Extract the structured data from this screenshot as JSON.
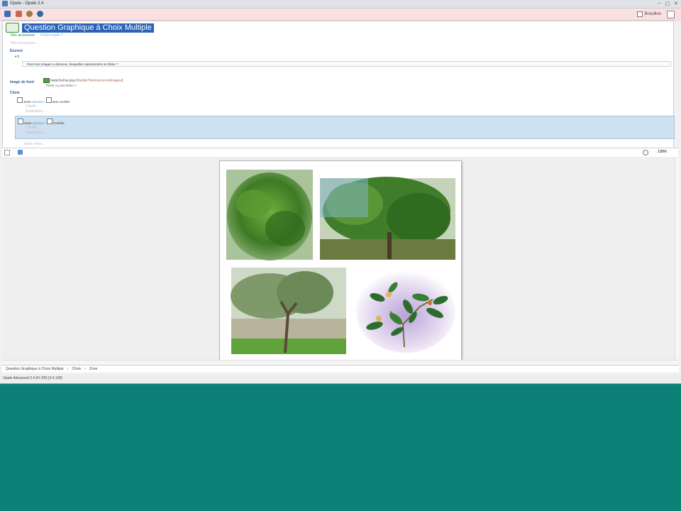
{
  "window": {
    "title": "Opale - Opale 3.4"
  },
  "toolbar": {
    "draft_label": "Brouillon"
  },
  "question": {
    "title": "Question Graphique à Choix Multiple",
    "tabs": [
      "Titre accessoire",
      "Plutôt inutile ?"
    ],
    "faint_placeholder": "Titre accessoire…"
  },
  "enonce": {
    "label": "Énoncé",
    "text": "Parmi les images ci-dessous, lesquelles représentent un théier ?"
  },
  "background_image": {
    "label": "Image de fond",
    "path_prefix": "MaterDuPax.png (",
    "path_link": "/ModuleThe/ressources/images/",
    "path_suffix": ")",
    "caption": "Théier ou pas théier ?"
  },
  "choices": {
    "label": "Choix",
    "items": [
      {
        "zone": "Zone",
        "solution": "Solution !",
        "state": "Non cochée",
        "sublabels": [
          "Libellé…",
          "Explication…"
        ]
      },
      {
        "zone": "Zone",
        "solution": "Solution !",
        "state": "Cochée",
        "sublabels": [
          "Libellé…",
          "Explication…"
        ]
      }
    ],
    "add_more": "Autre choix…"
  },
  "zoom": {
    "value": "100%"
  },
  "breadcrumb": [
    "Question Graphique à Choix Multiple",
    "Choix",
    "Zone"
  ],
  "status": {
    "text": "Opale Advanced 3.4 (Fr-FR) [3.4.100]"
  },
  "colors": {
    "accent": "#2b64b7",
    "teal_bg": "#0d8077",
    "toolbar_pink": "#fbe0e2",
    "selection": "#cfe0f0"
  },
  "icons": [
    "save-icon",
    "edit-icon",
    "search-icon",
    "help-icon",
    "image-icon",
    "zoom-icon"
  ]
}
